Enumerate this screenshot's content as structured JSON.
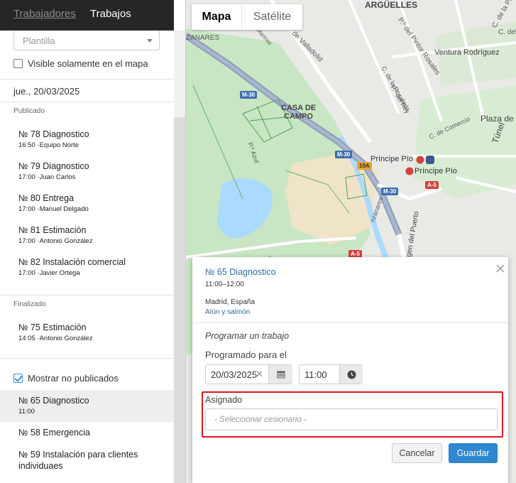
{
  "sidebar": {
    "tabs": [
      {
        "label": "Trabajadores",
        "active": false
      },
      {
        "label": "Trabajos",
        "active": true
      }
    ],
    "template_select": {
      "placeholder": "Plantilla"
    },
    "visible_on_map": {
      "label": "Visible solamente en el mapa",
      "checked": false
    },
    "date": "jue., 20/03/2025",
    "published": {
      "title": "Publicado",
      "jobs": [
        {
          "title": "№ 78 Diagnostico",
          "time": "16:50",
          "who": "Equipo Norte"
        },
        {
          "title": "№ 79 Diagnostico",
          "time": "17:00",
          "who": "Juan Carlos"
        },
        {
          "title": "№ 80 Entrega",
          "time": "17:00",
          "who": "Manuel Delgado"
        },
        {
          "title": "№ 81 Estimación",
          "time": "17:00",
          "who": "Antonio González"
        },
        {
          "title": "№ 82 Instalación comercial",
          "time": "17:00",
          "who": "Javier Ortega"
        }
      ]
    },
    "finished": {
      "title": "Finalizado",
      "jobs": [
        {
          "title": "№ 75 Estimación",
          "time": "14:05",
          "who": "Antonio González"
        }
      ]
    },
    "show_unpublished": {
      "label": "Mostrar no publicados",
      "checked": true
    },
    "unpublished": [
      {
        "title": "№ 65 Diagnostico",
        "time": "11:00",
        "selected": true
      },
      {
        "title": "№ 58 Emergencia"
      },
      {
        "title": "№ 59 Instalación para clientes individuaes"
      }
    ]
  },
  "map": {
    "type_control": {
      "map": "Mapa",
      "satellite": "Satélite"
    },
    "labels": {
      "arguelles": "ARGÜELLES",
      "princesa": "C. de la Princesa",
      "tutor": "C. del Tutor",
      "pintor_rosales": "P.º del Pintor Rosales",
      "ventura": "Ventura Rodríguez",
      "valladolid": "P.º de Valladolid",
      "marinas": "Ceto Marinas",
      "zanares": "ZANARES",
      "casa_de_campo_1": "CASA DE",
      "casa_de_campo_2": "CAMPO",
      "rosaleda": "C. de la Rosaleda",
      "rey": "P.º del Rey",
      "comercio": "C. de Comercio",
      "azul": "P.º Azul",
      "principe_pio_1": "Príncipe Pío",
      "principe_pio_2": "Príncipe Pío",
      "plaza": "Plaza de",
      "tunel": "Túnel",
      "virgen_puerto": "Virgen del Puerto",
      "zanares2": "nzanares"
    },
    "badges": {
      "m30a": "M-30",
      "m30b": "M-30",
      "m30c": "M-30",
      "a5a": "A-5",
      "a5b": "A-5",
      "r19": "19A"
    },
    "colors": {
      "water": "#aadaff",
      "park": "#c8e6c3",
      "road_main": "#8e9db9",
      "sand": "#efe4c8"
    }
  },
  "popup": {
    "job_title": "№ 65 Diagnostico",
    "time_range": "11:00–12:00",
    "place": "Madrid, España",
    "client": "Atún y salmón",
    "schedule_heading": "Programar un trabajo",
    "scheduled_for_label": "Programado para el",
    "date_value": "20/03/2025",
    "time_value": "11:00",
    "assigned_label": "Asignado",
    "assigned_placeholder": "- Seleccionar cesionario -",
    "cancel": "Cancelar",
    "save": "Guardar"
  }
}
